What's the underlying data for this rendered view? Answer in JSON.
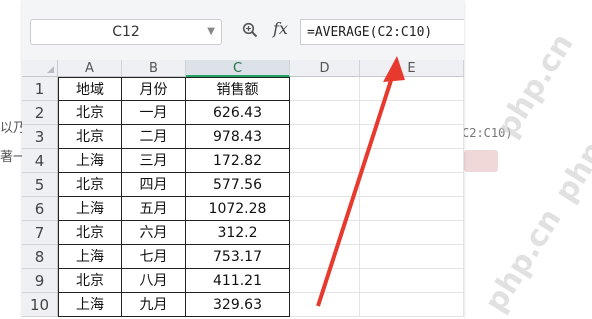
{
  "background": {
    "left_line_1": "以乃",
    "left_line_2": "著一",
    "right_line_1": "C2:C10)",
    "watermark": "php.cn"
  },
  "formula_bar": {
    "name_box": "C12",
    "fx_label": "fx",
    "formula": "=AVERAGE(C2:C10)"
  },
  "columns": [
    "A",
    "B",
    "C",
    "D",
    "E"
  ],
  "selected_column": "C",
  "rows": [
    {
      "num": "1",
      "region": "地域",
      "month": "月份",
      "sales": "销售额"
    },
    {
      "num": "2",
      "region": "北京",
      "month": "一月",
      "sales": "626.43"
    },
    {
      "num": "3",
      "region": "北京",
      "month": "二月",
      "sales": "978.43"
    },
    {
      "num": "4",
      "region": "上海",
      "month": "三月",
      "sales": "172.82"
    },
    {
      "num": "5",
      "region": "北京",
      "month": "四月",
      "sales": "577.56"
    },
    {
      "num": "6",
      "region": "上海",
      "month": "五月",
      "sales": "1072.28"
    },
    {
      "num": "7",
      "region": "北京",
      "month": "六月",
      "sales": "312.2"
    },
    {
      "num": "8",
      "region": "上海",
      "month": "七月",
      "sales": "753.17"
    },
    {
      "num": "9",
      "region": "北京",
      "month": "八月",
      "sales": "411.21"
    },
    {
      "num": "10",
      "region": "上海",
      "month": "九月",
      "sales": "329.63"
    }
  ],
  "colors": {
    "arrow": "#e8392f",
    "selected_header": "#1e7145"
  }
}
